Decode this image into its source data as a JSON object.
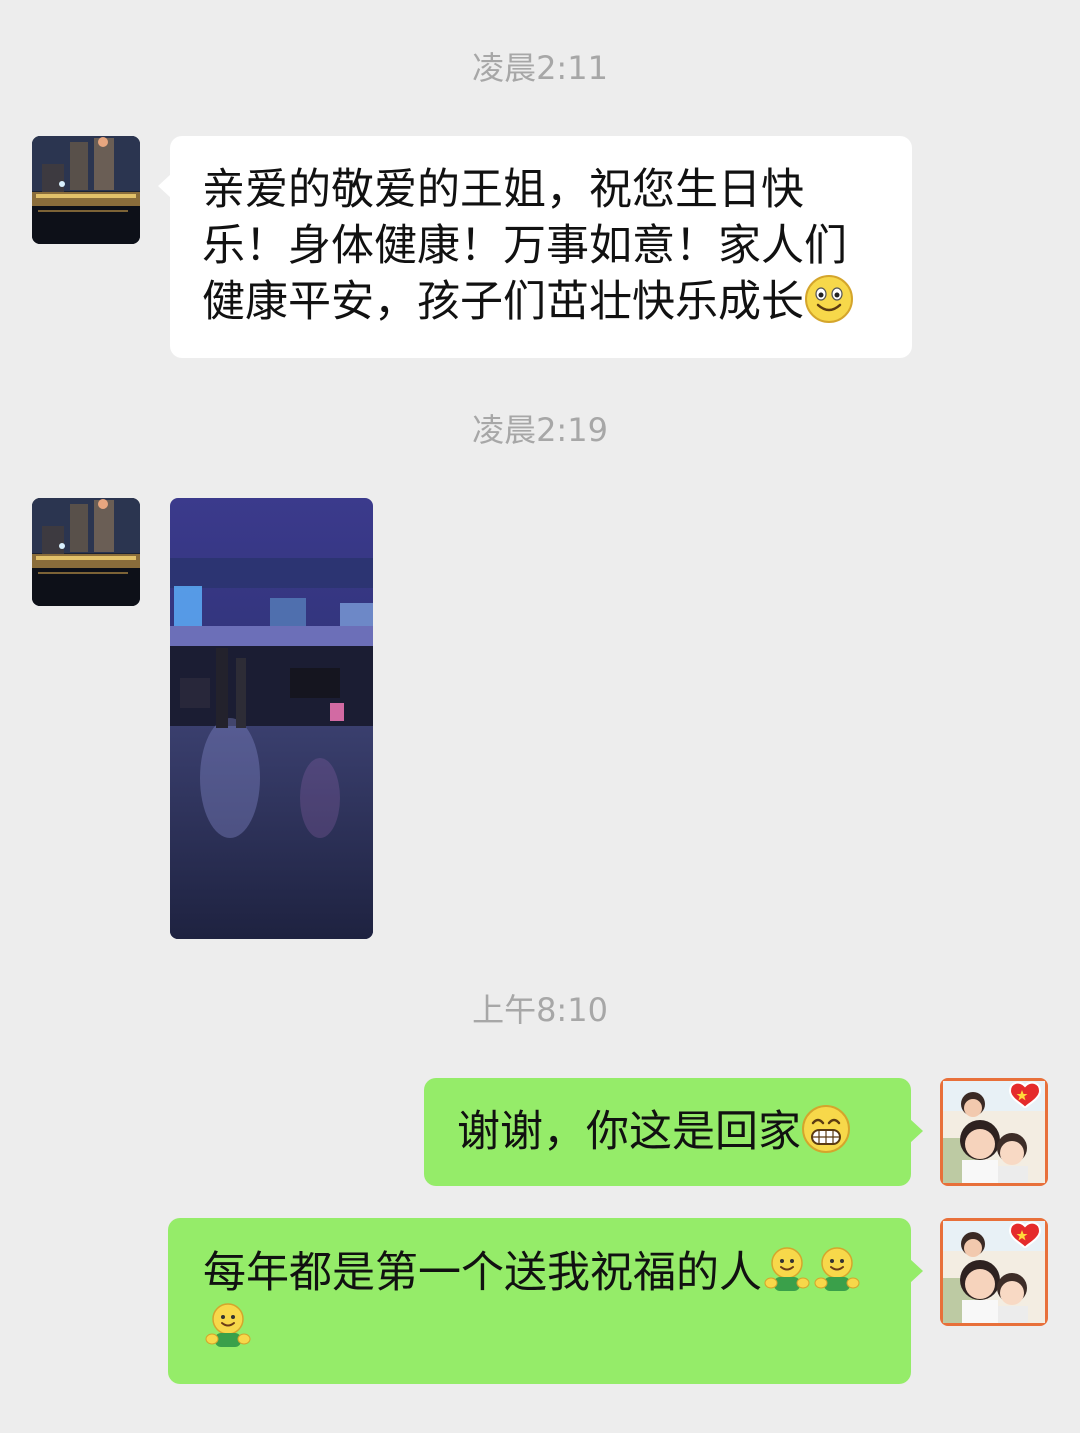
{
  "messages": {
    "time1": "凌晨2:11",
    "msg1": {
      "text": "亲爱的敬爱的王姐，祝您生日快乐！身体健康！万事如意！家人们健康平安，孩子们茁壮快乐成长",
      "emoji": "smile-emoji-icon"
    },
    "time2": "凌晨2:19",
    "msg2": {
      "type": "image",
      "subject": "station-hall-photo"
    },
    "time3": "上午8:10",
    "msg3": {
      "text": "谢谢，你这是回家",
      "emoji": "grin-emoji-icon"
    },
    "msg4": {
      "text": "每年都是第一个送我祝福的人",
      "emoji": "hug-emoji-icon",
      "emoji_count": 3
    }
  },
  "colors": {
    "background": "#ededed",
    "incoming_bubble": "#ffffff",
    "outgoing_bubble": "#95ec69",
    "timestamp": "#a7a7a7"
  }
}
